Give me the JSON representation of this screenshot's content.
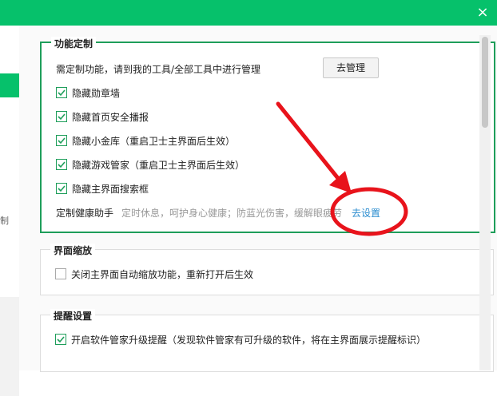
{
  "window": {
    "close_icon": "×"
  },
  "left": {
    "partial_char": "制"
  },
  "customize": {
    "title": "功能定制",
    "desc": "需定制功能，请到我的工具/全部工具中进行管理",
    "manage_button": "去管理",
    "options": [
      {
        "label": "隐藏勋章墙",
        "checked": true
      },
      {
        "label": "隐藏首页安全播报",
        "checked": true
      },
      {
        "label": "隐藏小金库（重启卫士主界面后生效）",
        "checked": true
      },
      {
        "label": "隐藏游戏管家（重启卫士主界面后生效）",
        "checked": true
      },
      {
        "label": "隐藏主界面搜索框",
        "checked": true
      }
    ],
    "health_label": "定制健康助手",
    "health_hint": "定时休息，呵护身心健康；防蓝光伤害，缓解眼疲劳",
    "health_link": "去设置"
  },
  "zoom": {
    "title": "界面缩放",
    "option": {
      "label": "关闭主界面自动缩放功能，重新打开后生效",
      "checked": false
    }
  },
  "reminder": {
    "title": "提醒设置",
    "option": {
      "label": "开启软件管家升级提醒（发现软件管家有可升级的软件，将在主界面展示提醒标识）",
      "checked": true
    }
  },
  "colors": {
    "accent": "#06c16b",
    "border": "#1e9e5a",
    "annotation": "#e8131b",
    "link": "#2a8ccf"
  }
}
